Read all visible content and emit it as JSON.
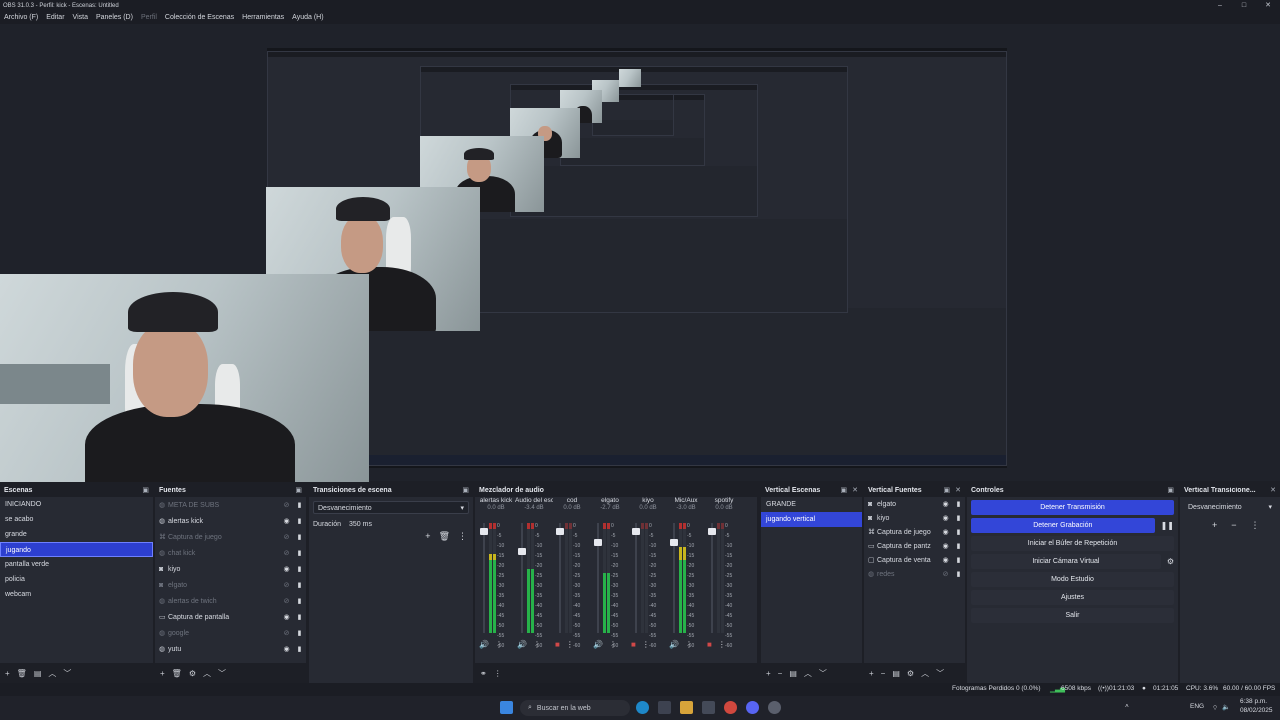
{
  "window": {
    "title": "OBS 31.0.3 - Perfil: kick - Escenas: Untitled",
    "controls": [
      "–",
      "□",
      "✕"
    ]
  },
  "menu": {
    "items": [
      "Archivo (F)",
      "Editar",
      "Vista",
      "Paneles (D)",
      "Perfil",
      "Colección de Escenas",
      "Herramientas",
      "Ayuda (H)"
    ]
  },
  "scenes": {
    "title": "Escenas",
    "items": [
      "INICIANDO",
      "se acabo",
      "grande",
      "jugando",
      "pantalla verde",
      "policia",
      "webcam"
    ],
    "selected_index": 3
  },
  "sources": {
    "title": "Fuentes",
    "items": [
      {
        "name": "META DE SUBS",
        "icon": "browser-icon",
        "visible": false
      },
      {
        "name": "alertas kick",
        "icon": "browser-icon",
        "visible": true
      },
      {
        "name": "Captura de juego",
        "icon": "gamepad-icon",
        "visible": false
      },
      {
        "name": "chat kick",
        "icon": "browser-icon",
        "visible": false
      },
      {
        "name": "kiyo",
        "icon": "camera-icon",
        "visible": true
      },
      {
        "name": "elgato",
        "icon": "camera-icon",
        "visible": false
      },
      {
        "name": "alertas de twich",
        "icon": "browser-icon",
        "visible": false
      },
      {
        "name": "Captura de pantalla",
        "icon": "monitor-icon",
        "visible": true
      },
      {
        "name": "google",
        "icon": "browser-icon",
        "visible": false
      },
      {
        "name": "yutu",
        "icon": "browser-icon",
        "visible": true
      }
    ]
  },
  "transitions": {
    "title": "Transiciones de escena",
    "selected": "Desvanecimiento",
    "duration_label": "Duración",
    "duration_value": "350 ms"
  },
  "mixer": {
    "title": "Mezclador de audio",
    "channels": [
      {
        "name": "alertas kick",
        "db": "0.0 dB",
        "level": 0.72,
        "fader": 0.95,
        "muted": false
      },
      {
        "name": "Audio del escrito",
        "db": "-3.4 dB",
        "level": 0.58,
        "fader": 0.76,
        "muted": false
      },
      {
        "name": "cod",
        "db": "0.0 dB",
        "level": 0.0,
        "fader": 0.95,
        "muted": true
      },
      {
        "name": "elgato",
        "db": "-2.7 dB",
        "level": 0.55,
        "fader": 0.85,
        "muted": false
      },
      {
        "name": "kiyo",
        "db": "0.0 dB",
        "level": 0.0,
        "fader": 0.95,
        "muted": true
      },
      {
        "name": "Mic/Aux",
        "db": "-3.0 dB",
        "level": 0.78,
        "fader": 0.85,
        "muted": false
      },
      {
        "name": "spotify",
        "db": "0.0 dB",
        "level": 0.0,
        "fader": 0.95,
        "muted": true
      }
    ],
    "scale": [
      "0",
      "-5",
      "-10",
      "-15",
      "-20",
      "-25",
      "-30",
      "-35",
      "-40",
      "-45",
      "-50",
      "-55",
      "-60"
    ]
  },
  "vertical_scenes": {
    "title": "Vertical Escenas",
    "items": [
      "GRANDE",
      "jugando vertical"
    ],
    "selected_index": 1
  },
  "vertical_sources": {
    "title": "Vertical Fuentes",
    "items": [
      {
        "name": "elgato",
        "icon": "camera-icon",
        "visible": true
      },
      {
        "name": "kiyo",
        "icon": "camera-icon",
        "visible": true
      },
      {
        "name": "Captura de juego",
        "icon": "gamepad-icon",
        "visible": true
      },
      {
        "name": "Captura de pantz",
        "icon": "monitor-icon",
        "visible": true
      },
      {
        "name": "Captura de venta",
        "icon": "window-icon",
        "visible": true
      },
      {
        "name": "redes",
        "icon": "browser-icon",
        "visible": false
      }
    ]
  },
  "controls": {
    "title": "Controles",
    "buttons": [
      {
        "label": "Detener Transmisión",
        "active": true
      },
      {
        "label": "Detener Grabación",
        "active": true
      },
      {
        "label": "Iniciar el Búfer de Repetición",
        "active": false
      },
      {
        "label": "Iniciar Cámara Virtual",
        "active": false
      },
      {
        "label": "Modo Estudio",
        "active": false
      },
      {
        "label": "Ajustes",
        "active": false
      },
      {
        "label": "Salir",
        "active": false
      }
    ]
  },
  "vertical_transitions": {
    "title": "Vertical Transicione...",
    "selected": "Desvanecimiento"
  },
  "status": {
    "dropped": "Fotogramas Perdidos 0 (0.0%)",
    "bitrate": "6508 kbps",
    "stream_time": "01:21:03",
    "rec_time": "01:21:05",
    "cpu": "CPU: 3.6%",
    "fps": "60.00 / 60.00 FPS"
  },
  "taskbar": {
    "search_placeholder": "Buscar en la web",
    "lang": "ENG",
    "time": "6:38 p.m.",
    "date": "08/02/2025"
  },
  "colors": {
    "accent": "#3346d8",
    "panel": "#272a33",
    "background": "#1d1f26"
  }
}
